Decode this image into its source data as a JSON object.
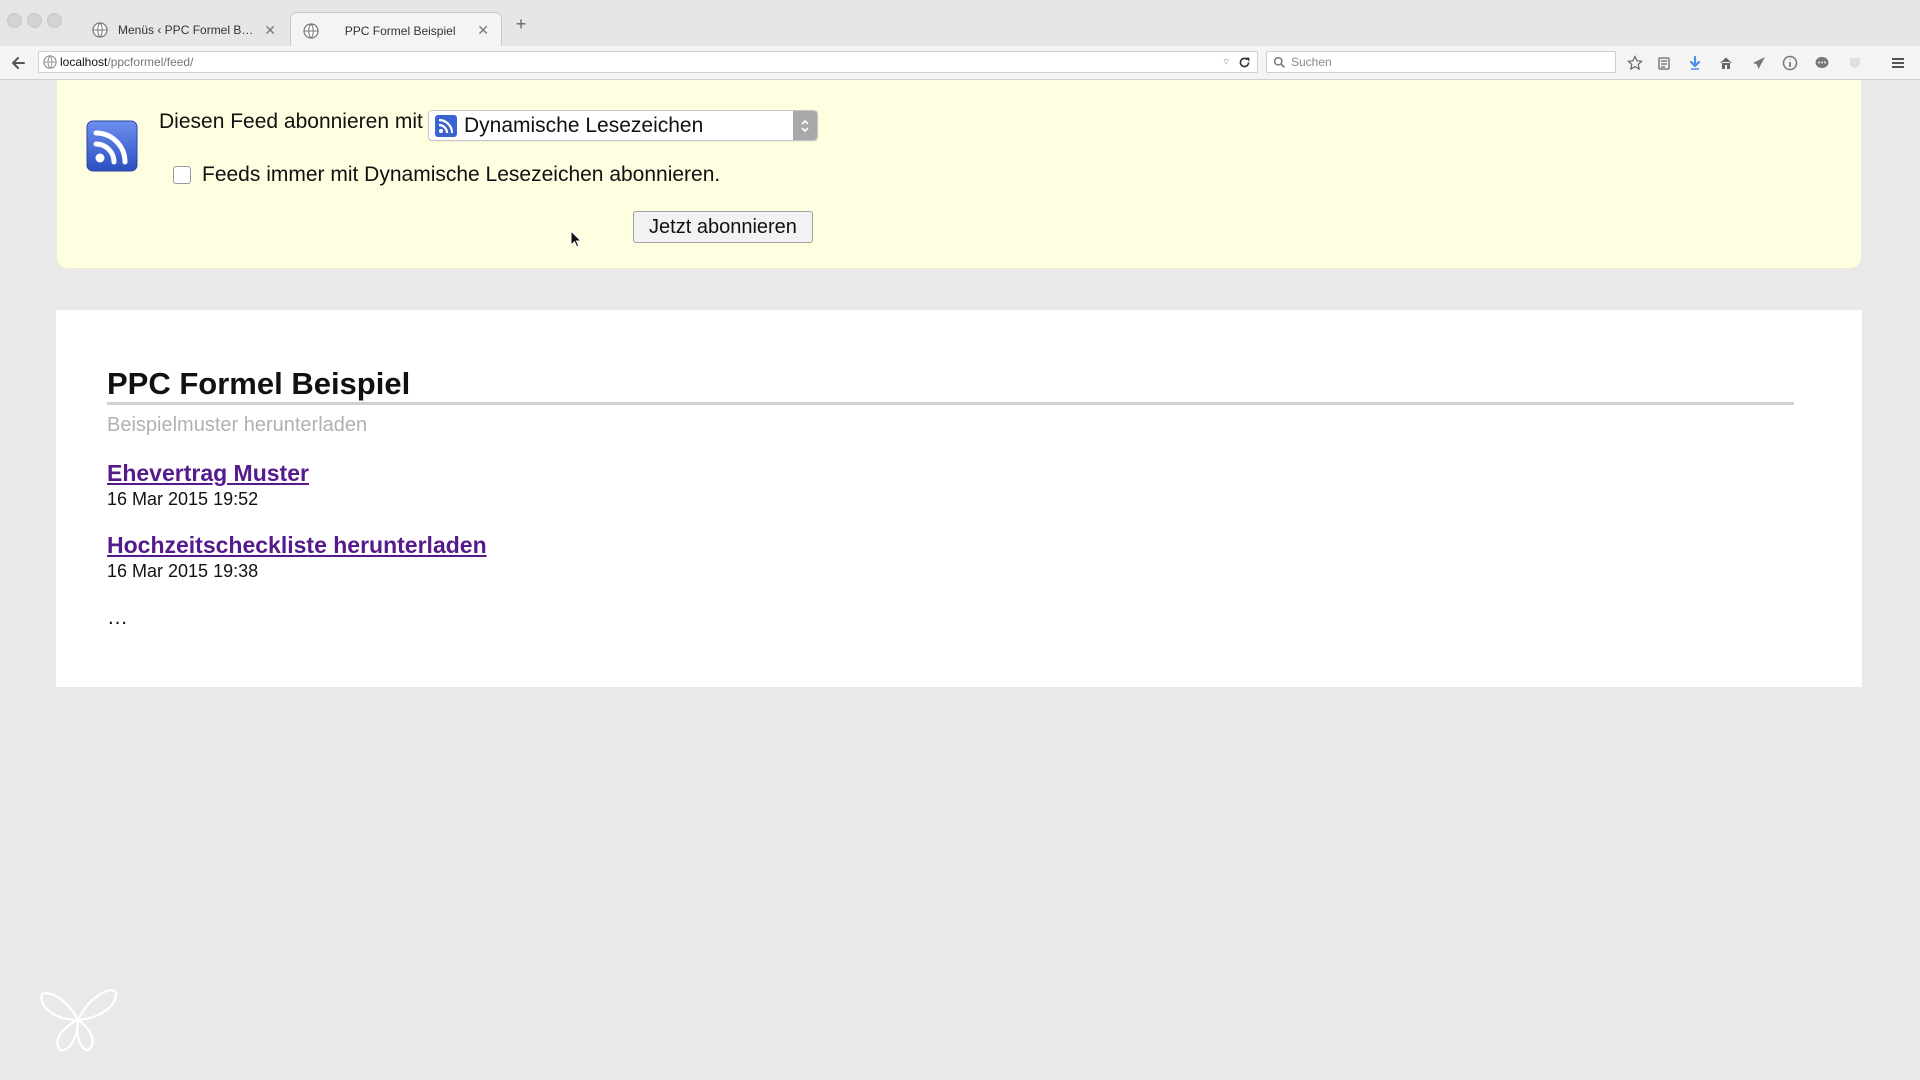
{
  "browser": {
    "tabs": [
      {
        "title": "Menüs ‹ PPC Formel Beispi...",
        "active": false
      },
      {
        "title": "PPC Formel Beispiel",
        "active": true
      }
    ],
    "url_host": "localhost",
    "url_path": "/ppcformel/feed/",
    "search_placeholder": "Suchen"
  },
  "subscribe": {
    "label": "Diesen Feed abonnieren mit",
    "reader_selected": "Dynamische Lesezeichen",
    "always_label": "Feeds immer mit Dynamische Lesezeichen abonnieren.",
    "always_checked": false,
    "button_label": "Jetzt abonnieren"
  },
  "feed": {
    "title": "PPC Formel Beispiel",
    "subtitle": "Beispielmuster herunterladen",
    "entries": [
      {
        "title": "Ehevertrag Muster",
        "date": "16 Mar 2015 19:52"
      },
      {
        "title": "Hochzeitscheckliste herunterladen",
        "date": "16 Mar 2015 19:38"
      }
    ],
    "more": "…"
  },
  "colors": {
    "banner_bg": "#fefee0",
    "visited_link": "#551a8b",
    "subtitle": "#b1b1b1",
    "rss_blue": "#3b63cf"
  }
}
